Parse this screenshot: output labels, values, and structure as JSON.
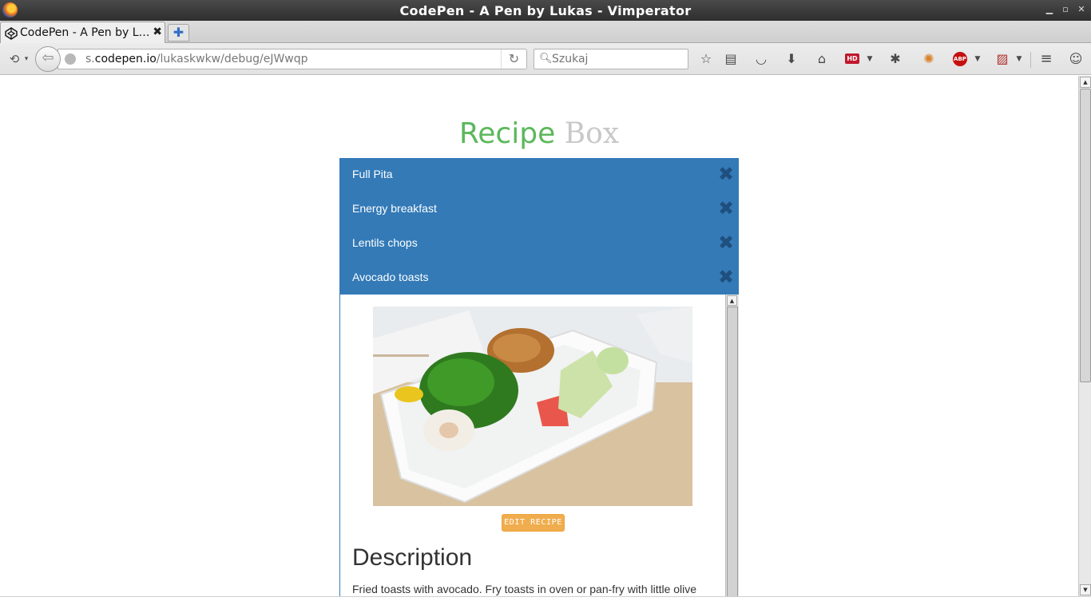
{
  "window": {
    "title": "CodePen - A Pen by Lukas - Vimperator"
  },
  "tabs": [
    {
      "label": "CodePen - A Pen by L…"
    }
  ],
  "navbar": {
    "url_prefix": "s.",
    "url_host": "codepen.io",
    "url_path": "/lukaskwkw/debug/eJWwqp",
    "search_placeholder": "Szukaj"
  },
  "page": {
    "title_part1": "Recipe",
    "title_part2": "Box",
    "recipes": [
      {
        "name": "Full Pita"
      },
      {
        "name": "Energy breakfast"
      },
      {
        "name": "Lentils chops"
      },
      {
        "name": "Avocado toasts"
      }
    ],
    "edit_button": "EDIT RECIPE",
    "description_heading": "Description",
    "description_text": "Fried toasts with avocado. Fry toasts in oven or pan-fry with little olive"
  },
  "colors": {
    "recipe_bar": "#337ab7",
    "title_green": "#5cb85c",
    "edit_button": "#f0ad4e"
  }
}
